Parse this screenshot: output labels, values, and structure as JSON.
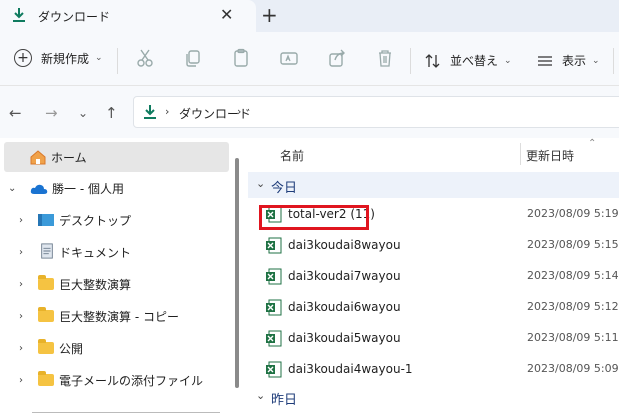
{
  "tab": {
    "title": "ダウンロード",
    "close_glyph": "✕",
    "new_tab_glyph": "+"
  },
  "toolbar": {
    "new_label": "新規作成",
    "sort_label": "並べ替え",
    "view_label": "表示",
    "caret": "⌄"
  },
  "nav": {
    "back": "←",
    "forward": "→",
    "recent": "⌄",
    "up": "↑"
  },
  "address": {
    "sep": "›",
    "location": "ダウンロード"
  },
  "sidebar": {
    "items": [
      {
        "label": "ホーム",
        "icon": "home-icon"
      },
      {
        "label": "勝一 - 個人用",
        "icon": "onedrive-cloud-icon"
      },
      {
        "label": "デスクトップ",
        "icon": "desktop-icon"
      },
      {
        "label": "ドキュメント",
        "icon": "document-icon"
      },
      {
        "label": "巨大整数演算",
        "icon": "folder-icon"
      },
      {
        "label": "巨大整数演算 - コピー",
        "icon": "folder-icon"
      },
      {
        "label": "公開",
        "icon": "folder-icon"
      },
      {
        "label": "電子メールの添付ファイル",
        "icon": "folder-icon"
      }
    ],
    "collapsed": "›",
    "expanded": "⌄"
  },
  "list": {
    "col_name": "名前",
    "col_date": "更新日時",
    "sort_glyph": "⌃",
    "group_today": "今日",
    "group_yesterday": "昨日",
    "group_caret": "⌄",
    "files": [
      {
        "name": "total-ver2 (11)",
        "date": "2023/08/09 5:19"
      },
      {
        "name": "dai3koudai8wayou",
        "date": "2023/08/09 5:15"
      },
      {
        "name": "dai3koudai7wayou",
        "date": "2023/08/09 5:14"
      },
      {
        "name": "dai3koudai6wayou",
        "date": "2023/08/09 5:12"
      },
      {
        "name": "dai3koudai5wayou",
        "date": "2023/08/09 5:11"
      },
      {
        "name": "dai3koudai4wayou-1",
        "date": "2023/08/09 5:09"
      }
    ]
  },
  "colors": {
    "accent": "#0f7b5f",
    "highlight": "#e0151f",
    "excel": "#1f7244"
  }
}
